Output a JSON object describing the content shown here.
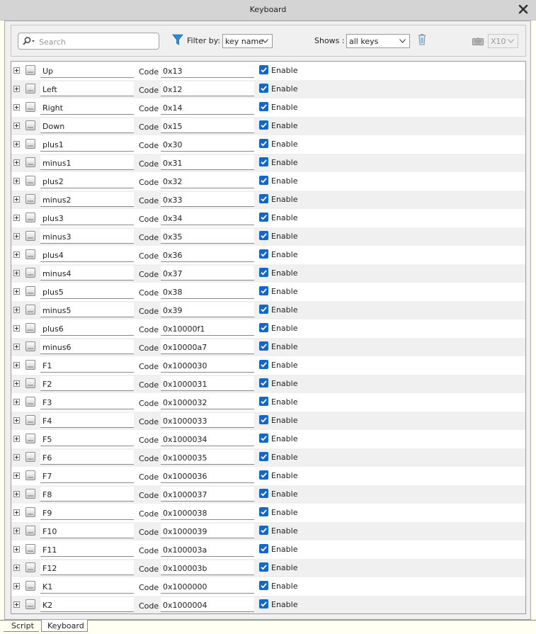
{
  "window": {
    "title": "Keyboard",
    "close_icon": "close-icon"
  },
  "toolbar": {
    "search_placeholder": "Search",
    "filter_label": "Filter by:",
    "filter_value": "key name",
    "shows_label": "Shows :",
    "shows_value": "all keys",
    "scale_value": "X10"
  },
  "rows": [
    {
      "name": "Up",
      "code": "0x13",
      "enabled": true
    },
    {
      "name": "Left",
      "code": "0x12",
      "enabled": true
    },
    {
      "name": "Right",
      "code": "0x14",
      "enabled": true
    },
    {
      "name": "Down",
      "code": "0x15",
      "enabled": true
    },
    {
      "name": "plus1",
      "code": "0x30",
      "enabled": true
    },
    {
      "name": "minus1",
      "code": "0x31",
      "enabled": true
    },
    {
      "name": "plus2",
      "code": "0x32",
      "enabled": true
    },
    {
      "name": "minus2",
      "code": "0x33",
      "enabled": true
    },
    {
      "name": "plus3",
      "code": "0x34",
      "enabled": true
    },
    {
      "name": "minus3",
      "code": "0x35",
      "enabled": true
    },
    {
      "name": "plus4",
      "code": "0x36",
      "enabled": true
    },
    {
      "name": "minus4",
      "code": "0x37",
      "enabled": true
    },
    {
      "name": "plus5",
      "code": "0x38",
      "enabled": true
    },
    {
      "name": "minus5",
      "code": "0x39",
      "enabled": true
    },
    {
      "name": "plus6",
      "code": "0x10000f1",
      "enabled": true
    },
    {
      "name": "minus6",
      "code": "0x10000a7",
      "enabled": true
    },
    {
      "name": "F1",
      "code": "0x1000030",
      "enabled": true
    },
    {
      "name": "F2",
      "code": "0x1000031",
      "enabled": true
    },
    {
      "name": "F3",
      "code": "0x1000032",
      "enabled": true
    },
    {
      "name": "F4",
      "code": "0x1000033",
      "enabled": true
    },
    {
      "name": "F5",
      "code": "0x1000034",
      "enabled": true
    },
    {
      "name": "F6",
      "code": "0x1000035",
      "enabled": true
    },
    {
      "name": "F7",
      "code": "0x1000036",
      "enabled": true
    },
    {
      "name": "F8",
      "code": "0x1000037",
      "enabled": true
    },
    {
      "name": "F9",
      "code": "0x1000038",
      "enabled": true
    },
    {
      "name": "F10",
      "code": "0x1000039",
      "enabled": true
    },
    {
      "name": "F11",
      "code": "0x100003a",
      "enabled": true
    },
    {
      "name": "F12",
      "code": "0x100003b",
      "enabled": true
    },
    {
      "name": "K1",
      "code": "0x1000000",
      "enabled": true
    },
    {
      "name": "K2",
      "code": "0x1000004",
      "enabled": true
    }
  ],
  "row_labels": {
    "code_label": "Code",
    "enable_label": "Enable"
  },
  "tabs": [
    {
      "label": "Script",
      "active": false
    },
    {
      "label": "Keyboard",
      "active": true
    }
  ],
  "colors": {
    "checkbox": "#1466c7",
    "filter_icon": "#2b8bd6",
    "title_bar": "#d4d4d4"
  }
}
